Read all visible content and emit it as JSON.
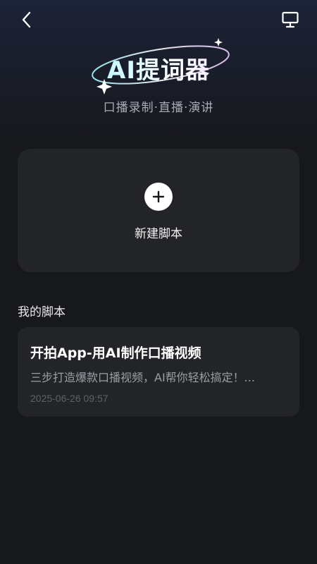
{
  "header": {
    "back_icon": "chevron-left-icon",
    "screen_icon": "monitor-icon"
  },
  "logo": {
    "title": "AI提词器",
    "subtitle": "口播录制·直播·演讲"
  },
  "new_script": {
    "icon": "plus-icon",
    "label": "新建脚本"
  },
  "my_scripts": {
    "section_title": "我的脚本",
    "items": [
      {
        "title": "开拍App-用AI制作口播视频",
        "description": "三步打造爆款口播视频，AI帮你轻松搞定！...",
        "date": "2025-06-26 09:57"
      }
    ]
  },
  "colors": {
    "background": "#17181c",
    "card": "#232427",
    "title_gradient_start": "#7ff3ff",
    "title_gradient_end": "#f3c8ff"
  }
}
